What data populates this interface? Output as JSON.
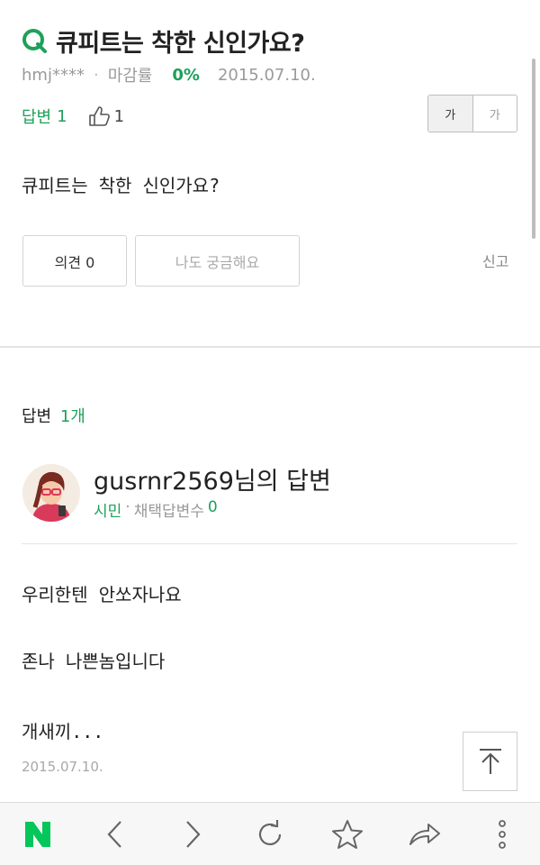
{
  "question": {
    "title": "큐피트는 착한 신인가요?",
    "author": "hmj****",
    "deadline_label": "마감률",
    "deadline_rate": "0%",
    "date": "2015.07.10.",
    "answers_label": "답변",
    "answers_count": "1",
    "likes": "1",
    "body": "큐피트는 착한 신인가요?",
    "opinion_button": "의견 0",
    "curious_button": "나도 궁금해요",
    "report": "신고"
  },
  "font_size_toggle": {
    "large": "가",
    "small": "가"
  },
  "answer_section": {
    "header_label": "답변",
    "header_count": "1개"
  },
  "answer": {
    "name": "gusrnr2569님의 답변",
    "rank": "시민",
    "adopted_label": "채택답변수",
    "adopted_count": "0",
    "lines": [
      "우리한텐 안쏘자나요",
      "존나 나쁜놈입니다",
      "개새끼..."
    ],
    "date": "2015.07.10."
  },
  "colors": {
    "accent_green": "#1fa05a",
    "naver_green": "#03c75a"
  },
  "toolbar": {
    "naver_logo": "N",
    "icons": [
      "naver-logo",
      "back-icon",
      "forward-icon",
      "refresh-icon",
      "bookmark-star-icon",
      "share-icon",
      "more-icon"
    ]
  }
}
